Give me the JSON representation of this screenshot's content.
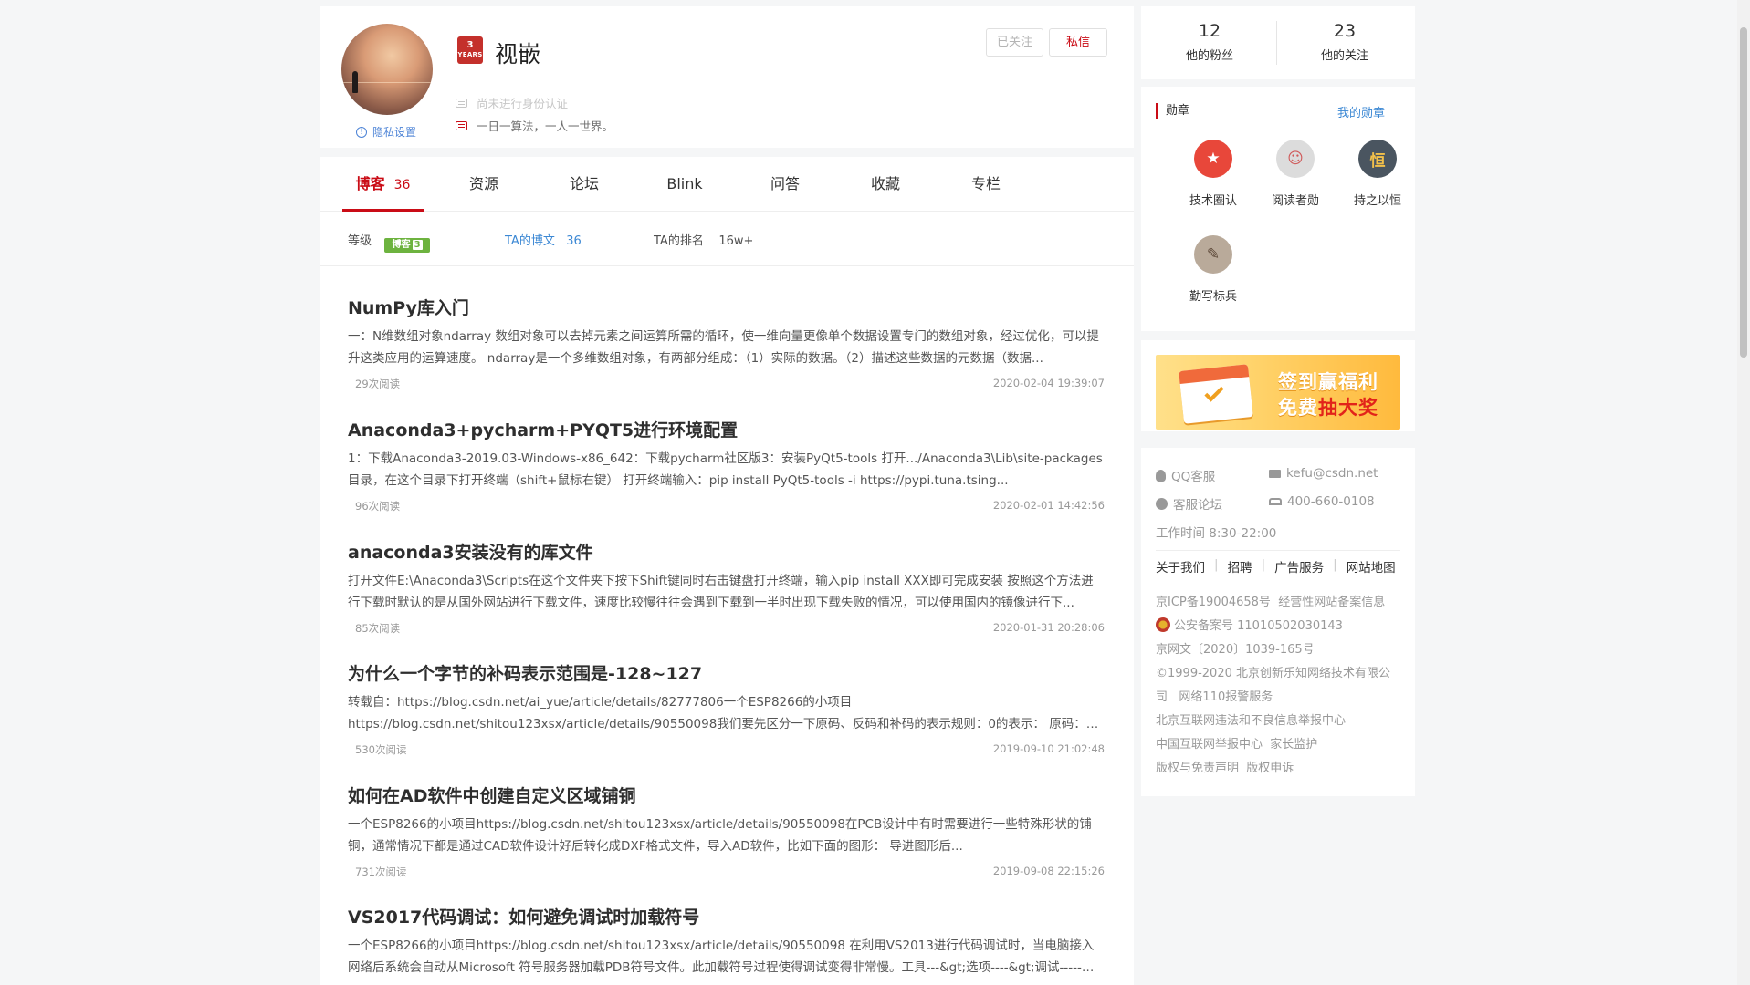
{
  "profile": {
    "years_badge_num": "3",
    "years_badge_text": "YEARS",
    "username": "视嵌",
    "privacy_label": "隐私设置",
    "followed_label": "已关注",
    "message_label": "私信",
    "verify_text": "尚未进行身份认证",
    "bio": "一日一算法，一人一世界。"
  },
  "tabs": [
    {
      "label": "博客",
      "count": "36"
    },
    {
      "label": "资源",
      "count": ""
    },
    {
      "label": "论坛",
      "count": ""
    },
    {
      "label": "Blink",
      "count": ""
    },
    {
      "label": "问答",
      "count": ""
    },
    {
      "label": "收藏",
      "count": ""
    },
    {
      "label": "专栏",
      "count": ""
    }
  ],
  "stats": {
    "level_label": "等级",
    "level_badge": "博客",
    "level_num": "3",
    "posts_label": "TA的博文",
    "posts_count": "36",
    "rank_label": "TA的排名",
    "rank_value": "16w+"
  },
  "articles": [
    {
      "title": "NumPy库入门",
      "summary": "一：N维数组对象ndarray 数组对象可以去掉元素之间运算所需的循环，使一维向量更像单个数据设置专门的数组对象，经过优化，可以提升这类应用的运算速度。 ndarray是一个多维数组对象，有两部分组成：（1）实际的数据。（2）描述这些数据的元数据（数据...",
      "reads": "29次阅读",
      "date": "2020-02-04 19:39:07"
    },
    {
      "title": "Anaconda3+pycharm+PYQT5进行环境配置",
      "summary": "1：下载Anaconda3-2019.03-Windows-x86_642：下载pycharm社区版3：安装PyQt5-tools 打开.../Anaconda3\\Lib\\site-packages目录，在这个目录下打开终端（shift+鼠标右键） 打开终端输入：pip install PyQt5-tools -i https://pypi.tuna.tsing...",
      "reads": "96次阅读",
      "date": "2020-02-01 14:42:56"
    },
    {
      "title": "anaconda3安装没有的库文件",
      "summary": "打开文件E:\\Anaconda3\\Scripts在这个文件夹下按下Shift键同时右击键盘打开终端，输入pip install XXX即可完成安装 按照这个方法进行下载时默认的是从国外网站进行下载文件，速度比较慢往往会遇到下载到一半时出现下载失败的情况，可以使用国内的镜像进行下...",
      "reads": "85次阅读",
      "date": "2020-01-31 20:28:06"
    },
    {
      "title": "为什么一个字节的补码表示范围是-128~127",
      "summary": "转载自：https://blog.csdn.net/ai_yue/article/details/82777806一个ESP8266的小项目https://blog.csdn.net/shitou123xsx/article/details/90550098我们要先区分一下原码、反码和补码的表示规则：0的表示： 原码：有正...",
      "reads": "530次阅读",
      "date": "2019-09-10 21:02:48"
    },
    {
      "title": "如何在AD软件中创建自定义区域铺铜",
      "summary": "一个ESP8266的小项目https://blog.csdn.net/shitou123xsx/article/details/90550098在PCB设计中有时需要进行一些特殊形状的铺铜，通常情况下都是通过CAD软件设计好后转化成DXF格式文件，导入AD软件，比如下面的图形： 导进图形后...",
      "reads": "731次阅读",
      "date": "2019-09-08 22:15:26"
    },
    {
      "title": "VS2017代码调试：如何避免调试时加载符号",
      "summary": "一个ESP8266的小项目https://blog.csdn.net/shitou123xsx/article/details/90550098 在利用VS2013进行代码调试时，当电脑接入网络后系统会自动从Microsoft 符号服务器加载PDB符号文件。此加载符号过程使得调试变得非常慢。工具---&gt;选项----&gt;调试-----&gt;符...",
      "reads": "",
      "date": ""
    }
  ],
  "fans": {
    "fans_count": "12",
    "fans_label": "他的粉丝",
    "follow_count": "23",
    "follow_label": "他的关注"
  },
  "medals": {
    "title": "勋章",
    "my_medals": "我的勋章",
    "items": [
      {
        "name": "技术圈认",
        "icon": "tech-circle-medal-icon",
        "glyph": "★",
        "color": "#e8473a"
      },
      {
        "name": "阅读者勋",
        "icon": "reader-medal-icon",
        "glyph": "☺",
        "color": "#d9d9d9"
      },
      {
        "name": "持之以恒",
        "icon": "perseverance-medal-icon",
        "glyph": "恒",
        "color": "#4a5560"
      },
      {
        "name": "勤写标兵",
        "icon": "diligent-writer-medal-icon",
        "glyph": "✎",
        "color": "#8c7a6b"
      }
    ]
  },
  "ad": {
    "line1": "签到赢福利",
    "line2_a": "免费",
    "line2_b": "抽大奖"
  },
  "footer": {
    "qq": "QQ客服",
    "email": "kefu@csdn.net",
    "forum": "客服论坛",
    "phone": "400-660-0108",
    "hours": "工作时间 8:30-22:00",
    "links": [
      "关于我们",
      "招聘",
      "广告服务",
      "网站地图"
    ],
    "legal_1": "京ICP备19004658号",
    "legal_1b": "经营性网站备案信息",
    "legal_2": "公安备案号 11010502030143",
    "legal_3": "京网文〔2020〕1039-165号",
    "legal_4": "©1999-2020 北京创新乐知网络技术有限公司",
    "legal_4b": "网络110报警服务",
    "legal_5": "北京互联网违法和不良信息举报中心",
    "legal_6": "中国互联网举报中心",
    "legal_6b": "家长监护",
    "legal_7": "版权与免责声明",
    "legal_7b": "版权申诉"
  },
  "colors": {
    "accent": "#ca0c16",
    "link": "#3c88d4",
    "level_green": "#6db33f",
    "page_bg": "#f5f6f7"
  }
}
